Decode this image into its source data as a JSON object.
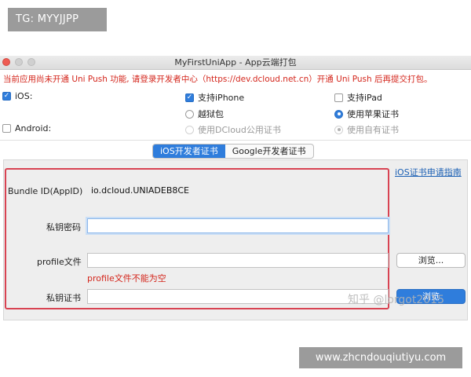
{
  "overlay": {
    "top_tag": "TG: MYYJJPP",
    "bottom_tag": "www.zhcndouqiutiyu.com",
    "watermark": "知乎 @lorgot2015"
  },
  "window": {
    "title": "MyFirstUniApp - App云端打包"
  },
  "warning": "当前应用尚未开通 Uni Push 功能, 请登录开发者中心（https://dev.dcloud.net.cn）开通 Uni Push 后再提交打包。",
  "options": {
    "ios": {
      "label": "iOS:",
      "checked": true
    },
    "android": {
      "label": "Android:",
      "checked": false
    },
    "iphone": {
      "label": "支持iPhone",
      "checked": true
    },
    "ipad": {
      "label": "支持iPad",
      "checked": false
    },
    "jailbreak": {
      "label": "越狱包",
      "selected": false
    },
    "apple_cert": {
      "label": "使用苹果证书",
      "selected": true
    },
    "dcloud_cert": {
      "label": "使用DCloud公用证书",
      "selected": false
    },
    "own_cert": {
      "label": "使用自有证书",
      "selected": true
    }
  },
  "tabs": [
    {
      "label": "iOS开发者证书",
      "active": true
    },
    {
      "label": "Google开发者证书",
      "active": false
    }
  ],
  "cert_form": {
    "guide_link": "iOS证书申请指南",
    "bundle_id_label": "Bundle ID(AppID)",
    "bundle_id_value": "io.dcloud.UNIADEB8CE",
    "private_key_password_label": "私钥密码",
    "private_key_password_value": "",
    "profile_label": "profile文件",
    "profile_value": "",
    "profile_error": "profile文件不能为空",
    "private_key_cert_label": "私钥证书",
    "private_key_cert_value": "",
    "browse_label": "浏览...",
    "browse2_label": "浏览"
  },
  "colors": {
    "accent": "#2f7ddc",
    "error": "#d4261c",
    "highlight_box": "#d84352"
  }
}
